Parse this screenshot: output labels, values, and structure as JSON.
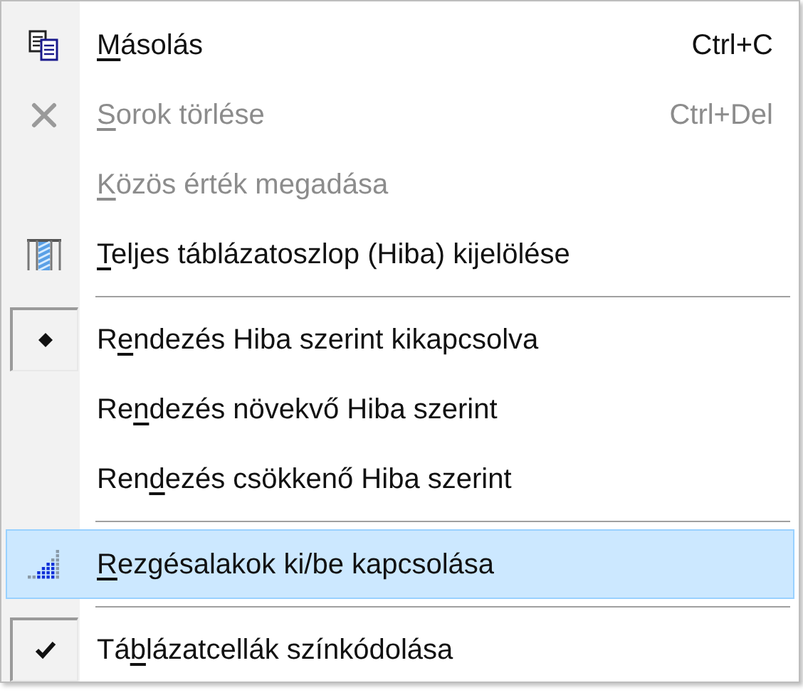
{
  "menu": {
    "items": [
      {
        "kind": "copy",
        "access_key": "M",
        "label_end": "ásolás",
        "shortcut": "Ctrl+C",
        "disabled": false,
        "selected": false
      },
      {
        "kind": "delete",
        "access_key": "S",
        "label_end": "orok törlése",
        "shortcut": "Ctrl+Del",
        "disabled": true,
        "selected": false
      },
      {
        "kind": "plain",
        "access_key": "K",
        "label_end": "özös érték megadása",
        "disabled": true,
        "selected": false
      },
      {
        "kind": "column",
        "access_key": "T",
        "label_end": "eljes táblázatoszlop (Hiba) kijelölése",
        "disabled": false,
        "selected": false
      },
      {
        "kind": "separator"
      },
      {
        "kind": "radio",
        "label_start": "R",
        "access_key": "e",
        "label_end": "ndezés Hiba szerint kikapcsolva",
        "checked": true,
        "disabled": false,
        "selected": false
      },
      {
        "kind": "radio",
        "label_start": "Re",
        "access_key": "n",
        "label_end": "dezés növekvő Hiba szerint",
        "checked": false,
        "disabled": false,
        "selected": false
      },
      {
        "kind": "radio",
        "label_start": "Ren",
        "access_key": "d",
        "label_end": "ezés csökkenő Hiba szerint",
        "checked": false,
        "disabled": false,
        "selected": false
      },
      {
        "kind": "separator"
      },
      {
        "kind": "modes",
        "access_key": "R",
        "label_end": "ezgésalakok ki/be kapcsolása",
        "disabled": false,
        "selected": true
      },
      {
        "kind": "separator"
      },
      {
        "kind": "check",
        "label_start": "Tá",
        "access_key": "b",
        "label_end": "lázatcellák színkódolása",
        "checked": true,
        "disabled": false,
        "selected": false
      }
    ]
  }
}
